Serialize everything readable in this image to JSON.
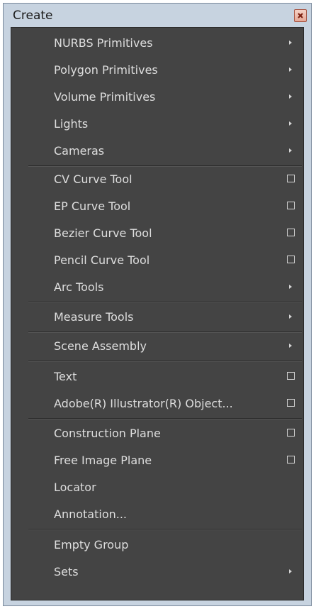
{
  "window": {
    "title": "Create"
  },
  "menu": {
    "items": [
      {
        "label": "NURBS Primitives",
        "kind": "submenu"
      },
      {
        "label": "Polygon Primitives",
        "kind": "submenu"
      },
      {
        "label": "Volume Primitives",
        "kind": "submenu"
      },
      {
        "label": "Lights",
        "kind": "submenu"
      },
      {
        "label": "Cameras",
        "kind": "submenu"
      },
      {
        "label": "CV Curve Tool",
        "kind": "option"
      },
      {
        "label": "EP Curve Tool",
        "kind": "option"
      },
      {
        "label": "Bezier Curve Tool",
        "kind": "option"
      },
      {
        "label": "Pencil Curve Tool",
        "kind": "option"
      },
      {
        "label": "Arc Tools",
        "kind": "submenu"
      },
      {
        "label": "Measure Tools",
        "kind": "submenu"
      },
      {
        "label": "Scene Assembly",
        "kind": "submenu"
      },
      {
        "label": "Text",
        "kind": "option"
      },
      {
        "label": "Adobe(R) Illustrator(R) Object...",
        "kind": "option"
      },
      {
        "label": "Construction Plane",
        "kind": "option"
      },
      {
        "label": "Free Image Plane",
        "kind": "option"
      },
      {
        "label": "Locator",
        "kind": "plain"
      },
      {
        "label": "Annotation...",
        "kind": "plain"
      },
      {
        "label": "Empty Group",
        "kind": "plain"
      },
      {
        "label": "Sets",
        "kind": "submenu"
      }
    ]
  }
}
